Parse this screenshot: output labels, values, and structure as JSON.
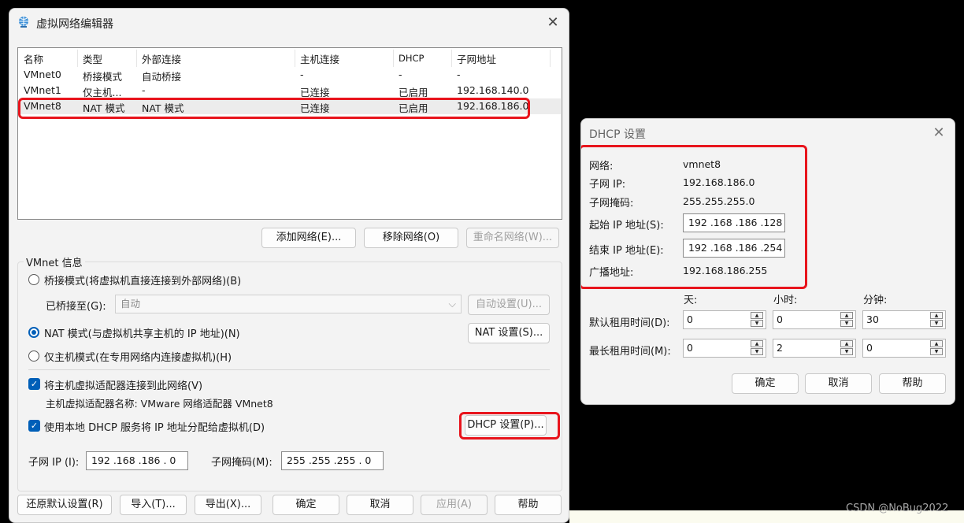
{
  "main": {
    "title": "虚拟网络编辑器",
    "table": {
      "headers": [
        "名称",
        "类型",
        "外部连接",
        "主机连接",
        "DHCP",
        "子网地址"
      ],
      "rows": [
        [
          "VMnet0",
          "桥接模式",
          "自动桥接",
          "-",
          "-",
          "-"
        ],
        [
          "VMnet1",
          "仅主机...",
          "-",
          "已连接",
          "已启用",
          "192.168.140.0"
        ],
        [
          "VMnet8",
          "NAT 模式",
          "NAT 模式",
          "已连接",
          "已启用",
          "192.168.186.0"
        ]
      ]
    },
    "buttons": {
      "add_network": "添加网络(E)...",
      "remove_network": "移除网络(O)",
      "rename_network": "重命名网络(W)..."
    },
    "info_title": "VMnet 信息",
    "bridge_mode": "桥接模式(将虚拟机直接连接到外部网络)(B)",
    "bridged_to_label": "已桥接至(G):",
    "bridged_to_value": "自动",
    "auto_settings": "自动设置(U)...",
    "nat_mode": "NAT 模式(与虚拟机共享主机的 IP 地址)(N)",
    "nat_settings": "NAT 设置(S)...",
    "host_only_mode": "仅主机模式(在专用网络内连接虚拟机)(H)",
    "connect_adapter": "将主机虚拟适配器连接到此网络(V)",
    "adapter_name": "主机虚拟适配器名称: VMware 网络适配器 VMnet8",
    "use_dhcp": "使用本地 DHCP 服务将 IP 地址分配给虚拟机(D)",
    "dhcp_settings": "DHCP 设置(P)...",
    "subnet_ip_label": "子网 IP (I):",
    "subnet_ip_value": "192 .168 .186 .  0",
    "subnet_mask_label": "子网掩码(M):",
    "subnet_mask_value": "255 .255 .255 .  0",
    "footer": {
      "restore_defaults": "还原默认设置(R)",
      "import": "导入(T)...",
      "export": "导出(X)...",
      "ok": "确定",
      "cancel": "取消",
      "apply": "应用(A)",
      "help": "帮助"
    }
  },
  "dhcp": {
    "title": "DHCP 设置",
    "network_label": "网络:",
    "network_value": "vmnet8",
    "subnet_ip_label": "子网 IP:",
    "subnet_ip_value": "192.168.186.0",
    "subnet_mask_label": "子网掩码:",
    "subnet_mask_value": "255.255.255.0",
    "start_ip_label": "起始 IP 地址(S):",
    "start_ip_value": "192 .168 .186 .128",
    "end_ip_label": "结束 IP 地址(E):",
    "end_ip_value": "192 .168 .186 .254",
    "broadcast_label": "广播地址:",
    "broadcast_value": "192.168.186.255",
    "col_days": "天:",
    "col_hours": "小时:",
    "col_minutes": "分钟:",
    "default_lease_label": "默认租用时间(D):",
    "default_lease": [
      "0",
      "0",
      "30"
    ],
    "max_lease_label": "最长租用时间(M):",
    "max_lease": [
      "0",
      "2",
      "0"
    ],
    "ok": "确定",
    "cancel": "取消",
    "help": "帮助"
  },
  "watermark": "CSDN @NoBug2022",
  "colors": {
    "highlight": "#e8141c",
    "accent": "#005fb8"
  }
}
